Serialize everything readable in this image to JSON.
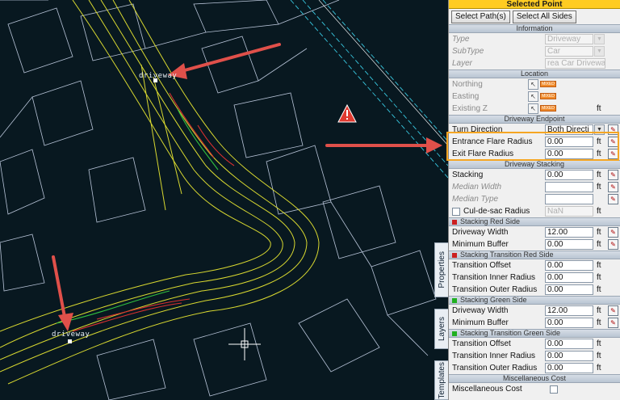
{
  "canvas": {
    "label_top": "driveway",
    "label_bottom": "driveway",
    "warning_icon": "warning-icon",
    "colors": {
      "background": "#081820",
      "annotation_arrow": "#e0504a",
      "highlight": "#f5a623"
    }
  },
  "side_tabs": [
    "Properties",
    "Layers",
    "Templates"
  ],
  "panel": {
    "title": "Selected Point",
    "buttons": [
      "Select Path(s)",
      "Select All Sides"
    ],
    "information": {
      "header": "Information",
      "type": {
        "label": "Type",
        "value": "Driveway"
      },
      "subtype": {
        "label": "SubType",
        "value": "Car"
      },
      "layer": {
        "label": "Layer",
        "value": "rea Car Driveway"
      }
    },
    "location": {
      "header": "Location",
      "northing": {
        "label": "Northing",
        "tag": "MIXED"
      },
      "easting": {
        "label": "Easting",
        "tag": "MIXED"
      },
      "existing_z": {
        "label": "Existing Z",
        "tag": "MIXED",
        "unit": "ft"
      }
    },
    "endpoint": {
      "header": "Driveway Endpoint",
      "turn_direction": {
        "label": "Turn Direction",
        "value": "Both Directi"
      },
      "entrance_flare": {
        "label": "Entrance Flare Radius",
        "value": "0.00",
        "unit": "ft"
      },
      "exit_flare": {
        "label": "Exit Flare Radius",
        "value": "0.00",
        "unit": "ft"
      }
    },
    "stacking": {
      "header": "Driveway Stacking",
      "stacking": {
        "label": "Stacking",
        "value": "0.00",
        "unit": "ft"
      },
      "median_width": {
        "label": "Median Width",
        "value": "",
        "unit": "ft"
      },
      "median_type": {
        "label": "Median Type",
        "value": ""
      },
      "culdesac": {
        "label": "Cul-de-sac Radius",
        "value": "NaN",
        "unit": "ft"
      }
    },
    "red_side": {
      "header": "Stacking Red Side",
      "color": "#cc2020",
      "width": {
        "label": "Driveway Width",
        "value": "12.00",
        "unit": "ft"
      },
      "buffer": {
        "label": "Minimum Buffer",
        "value": "0.00",
        "unit": "ft"
      }
    },
    "red_transition": {
      "header": "Stacking Transition Red Side",
      "color": "#cc2020",
      "offset": {
        "label": "Transition Offset",
        "value": "0.00",
        "unit": "ft"
      },
      "inner": {
        "label": "Transition Inner Radius",
        "value": "0.00",
        "unit": "ft"
      },
      "outer": {
        "label": "Transition Outer Radius",
        "value": "0.00",
        "unit": "ft"
      }
    },
    "green_side": {
      "header": "Stacking Green Side",
      "color": "#20b020",
      "width": {
        "label": "Driveway Width",
        "value": "12.00",
        "unit": "ft"
      },
      "buffer": {
        "label": "Minimum Buffer",
        "value": "0.00",
        "unit": "ft"
      }
    },
    "green_transition": {
      "header": "Stacking Transition Green Side",
      "color": "#20b020",
      "offset": {
        "label": "Transition Offset",
        "value": "0.00",
        "unit": "ft"
      },
      "inner": {
        "label": "Transition Inner Radius",
        "value": "0.00",
        "unit": "ft"
      },
      "outer": {
        "label": "Transition Outer Radius",
        "value": "0.00",
        "unit": "ft"
      }
    },
    "misc": {
      "header": "Miscellaneous Cost",
      "cost": {
        "label": "Miscellaneous Cost"
      }
    }
  }
}
